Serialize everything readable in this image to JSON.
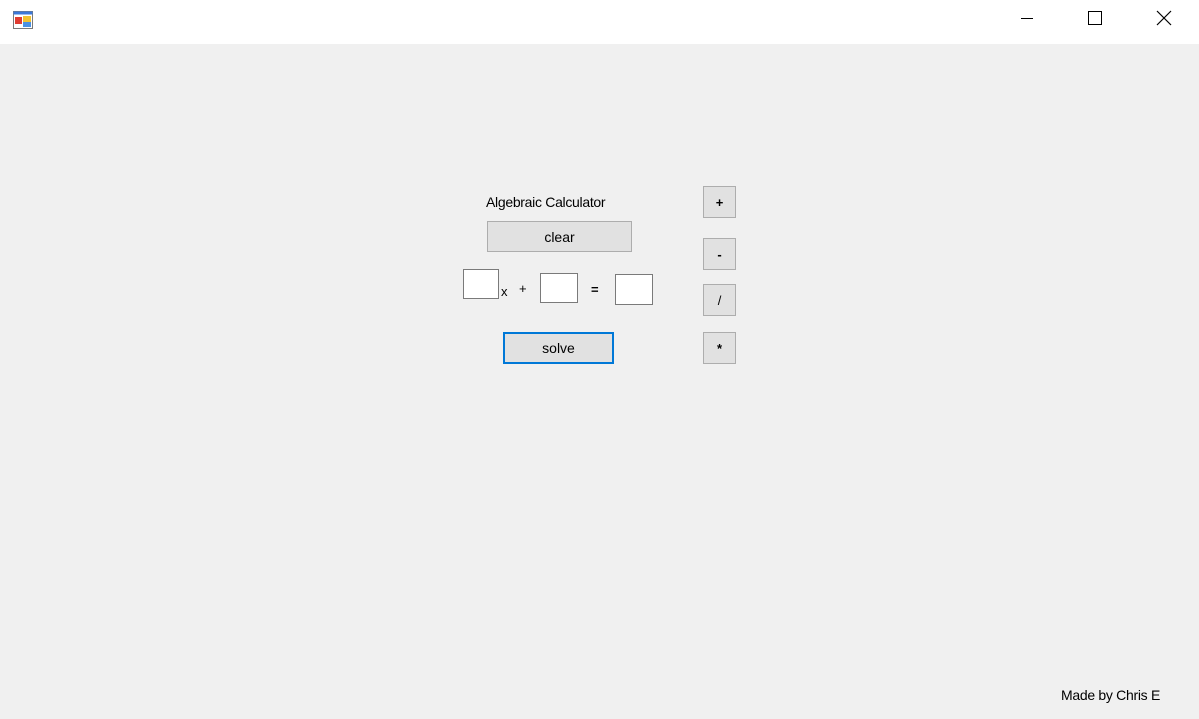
{
  "window": {
    "icon": "app-form-icon",
    "controls": {
      "minimize": "minimize-icon",
      "maximize": "maximize-icon",
      "close": "close-icon"
    }
  },
  "main": {
    "title": "Algebraic Calculator",
    "clear_label": "clear",
    "solve_label": "solve",
    "equation": {
      "coefficient_value": "",
      "variable_label": "x",
      "plus_label": "+",
      "constant_value": "",
      "equals_label": "=",
      "result_value": ""
    },
    "operators": {
      "plus": "+",
      "minus": "-",
      "divide": "/",
      "multiply": "*"
    },
    "footer": "Made by Chris E"
  },
  "colors": {
    "window_bg": "#f0f0f0",
    "titlebar_bg": "#ffffff",
    "button_bg": "#e1e1e1",
    "button_border": "#adadad",
    "focus_accent": "#0078d7"
  }
}
